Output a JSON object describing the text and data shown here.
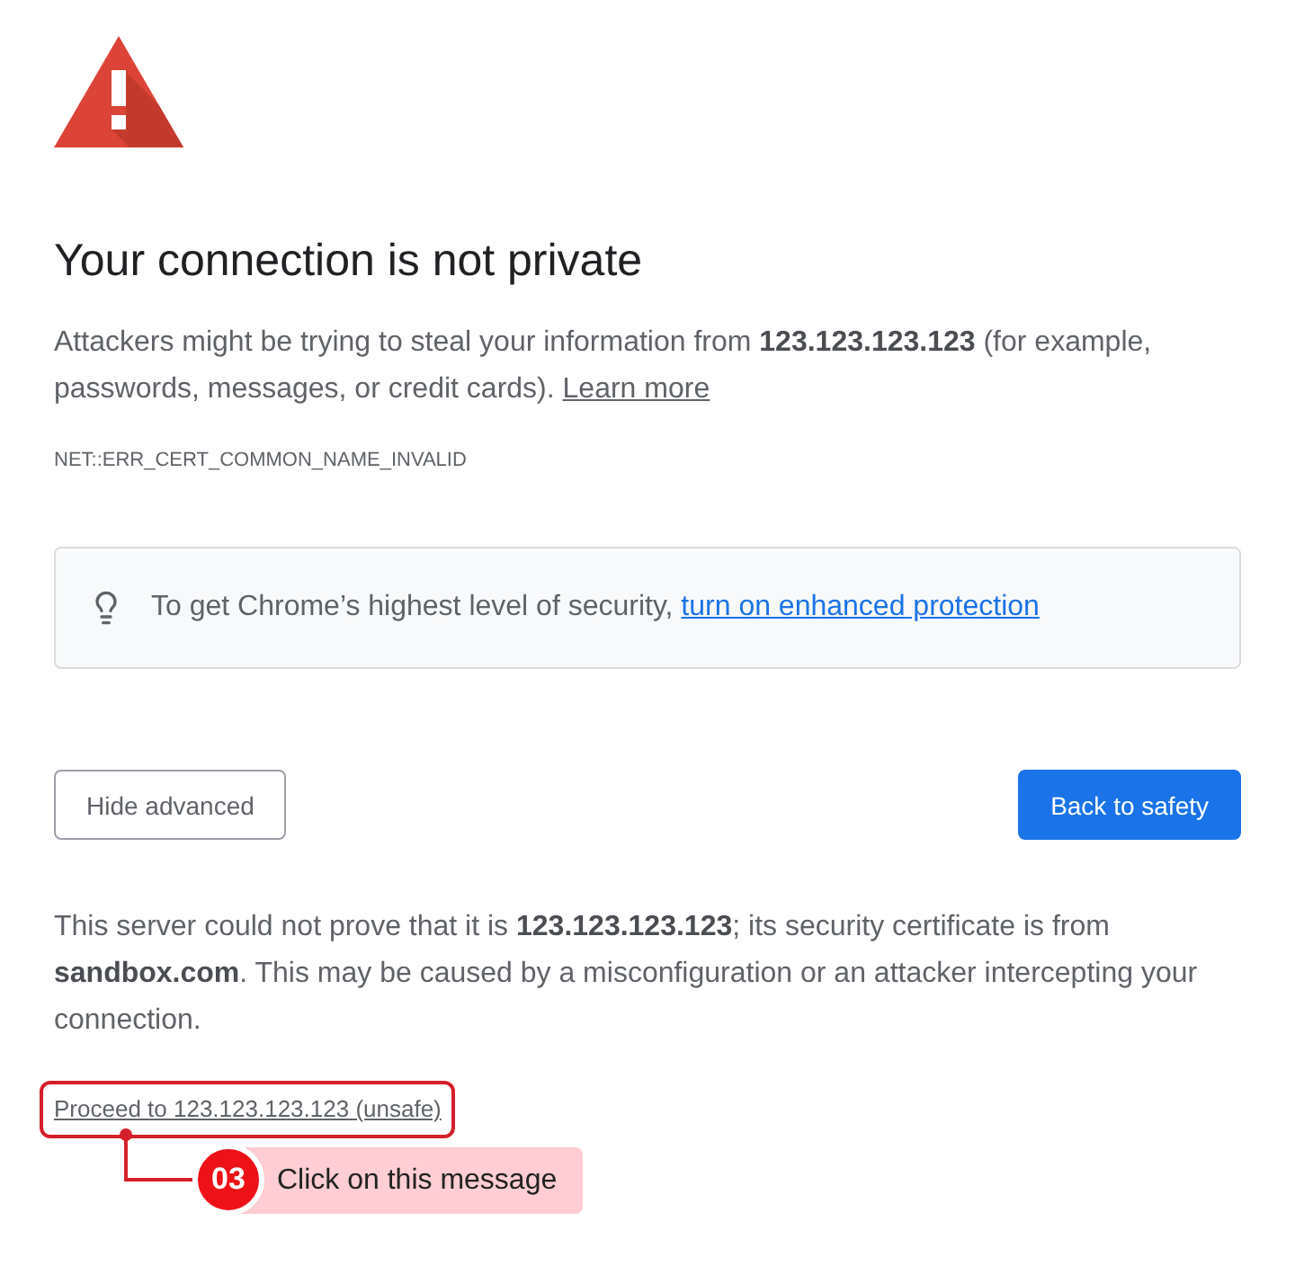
{
  "heading": "Your connection is not private",
  "intro": {
    "text": "Attackers might be trying to steal your information from **123.123.123.123** (for example, passwords, messages, or credit cards).",
    "link": "Learn more"
  },
  "error_code": "NET::ERR_CERT_COMMON_NAME_INVALID",
  "security_tip": {
    "text": "To get Chrome’s highest level of security,",
    "link": "turn on enhanced protection"
  },
  "buttons": [
    {
      "label": "Hide advanced",
      "kind": "secondary"
    },
    {
      "label": "Back to safety",
      "kind": "primary"
    }
  ],
  "details": "This server could not prove that it is **123.123.123.123**; its security certificate is from **sandbox.com**. This may be caused by a misconfiguration or an attacker intercepting your connection.",
  "proceed_link": "Proceed to 123.123.123.123 (unsafe)",
  "annotation": {
    "step": "03",
    "text": "Click on this message"
  }
}
